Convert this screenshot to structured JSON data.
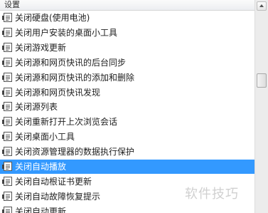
{
  "header": {
    "title": "设置"
  },
  "items": [
    {
      "label": "关闭硬盘(使用电池)"
    },
    {
      "label": "关闭用户安装的桌面小工具"
    },
    {
      "label": "关闭游戏更新"
    },
    {
      "label": "关闭源和网页快讯的后台同步"
    },
    {
      "label": "关闭源和网页快讯的添加和删除"
    },
    {
      "label": "关闭源和网页快讯发现"
    },
    {
      "label": "关闭源列表"
    },
    {
      "label": "关闭重新打开上次浏览会话"
    },
    {
      "label": "关闭桌面小工具"
    },
    {
      "label": "关闭资源管理器的数据执行保护"
    },
    {
      "label": "关闭自动播放",
      "selected": true
    },
    {
      "label": "关闭自动根证书更新"
    },
    {
      "label": "关闭自动故障恢复提示"
    },
    {
      "label": "关闭自动更新"
    }
  ],
  "icons": {
    "item": "policy-setting-icon"
  },
  "watermark": {
    "text": "软件技巧"
  },
  "colors": {
    "selection": "#3399ff"
  }
}
